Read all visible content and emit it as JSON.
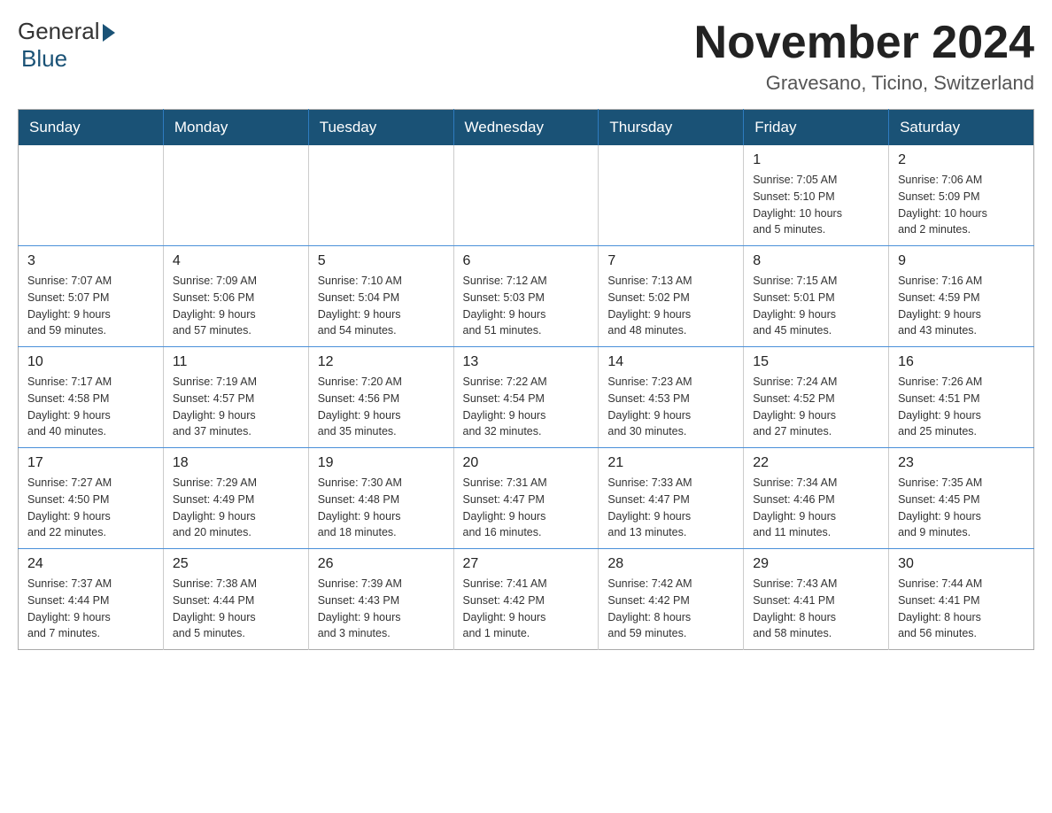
{
  "header": {
    "logo_general": "General",
    "logo_blue": "Blue",
    "month_title": "November 2024",
    "location": "Gravesano, Ticino, Switzerland"
  },
  "weekdays": [
    "Sunday",
    "Monday",
    "Tuesday",
    "Wednesday",
    "Thursday",
    "Friday",
    "Saturday"
  ],
  "weeks": [
    [
      {
        "day": "",
        "info": ""
      },
      {
        "day": "",
        "info": ""
      },
      {
        "day": "",
        "info": ""
      },
      {
        "day": "",
        "info": ""
      },
      {
        "day": "",
        "info": ""
      },
      {
        "day": "1",
        "info": "Sunrise: 7:05 AM\nSunset: 5:10 PM\nDaylight: 10 hours\nand 5 minutes."
      },
      {
        "day": "2",
        "info": "Sunrise: 7:06 AM\nSunset: 5:09 PM\nDaylight: 10 hours\nand 2 minutes."
      }
    ],
    [
      {
        "day": "3",
        "info": "Sunrise: 7:07 AM\nSunset: 5:07 PM\nDaylight: 9 hours\nand 59 minutes."
      },
      {
        "day": "4",
        "info": "Sunrise: 7:09 AM\nSunset: 5:06 PM\nDaylight: 9 hours\nand 57 minutes."
      },
      {
        "day": "5",
        "info": "Sunrise: 7:10 AM\nSunset: 5:04 PM\nDaylight: 9 hours\nand 54 minutes."
      },
      {
        "day": "6",
        "info": "Sunrise: 7:12 AM\nSunset: 5:03 PM\nDaylight: 9 hours\nand 51 minutes."
      },
      {
        "day": "7",
        "info": "Sunrise: 7:13 AM\nSunset: 5:02 PM\nDaylight: 9 hours\nand 48 minutes."
      },
      {
        "day": "8",
        "info": "Sunrise: 7:15 AM\nSunset: 5:01 PM\nDaylight: 9 hours\nand 45 minutes."
      },
      {
        "day": "9",
        "info": "Sunrise: 7:16 AM\nSunset: 4:59 PM\nDaylight: 9 hours\nand 43 minutes."
      }
    ],
    [
      {
        "day": "10",
        "info": "Sunrise: 7:17 AM\nSunset: 4:58 PM\nDaylight: 9 hours\nand 40 minutes."
      },
      {
        "day": "11",
        "info": "Sunrise: 7:19 AM\nSunset: 4:57 PM\nDaylight: 9 hours\nand 37 minutes."
      },
      {
        "day": "12",
        "info": "Sunrise: 7:20 AM\nSunset: 4:56 PM\nDaylight: 9 hours\nand 35 minutes."
      },
      {
        "day": "13",
        "info": "Sunrise: 7:22 AM\nSunset: 4:54 PM\nDaylight: 9 hours\nand 32 minutes."
      },
      {
        "day": "14",
        "info": "Sunrise: 7:23 AM\nSunset: 4:53 PM\nDaylight: 9 hours\nand 30 minutes."
      },
      {
        "day": "15",
        "info": "Sunrise: 7:24 AM\nSunset: 4:52 PM\nDaylight: 9 hours\nand 27 minutes."
      },
      {
        "day": "16",
        "info": "Sunrise: 7:26 AM\nSunset: 4:51 PM\nDaylight: 9 hours\nand 25 minutes."
      }
    ],
    [
      {
        "day": "17",
        "info": "Sunrise: 7:27 AM\nSunset: 4:50 PM\nDaylight: 9 hours\nand 22 minutes."
      },
      {
        "day": "18",
        "info": "Sunrise: 7:29 AM\nSunset: 4:49 PM\nDaylight: 9 hours\nand 20 minutes."
      },
      {
        "day": "19",
        "info": "Sunrise: 7:30 AM\nSunset: 4:48 PM\nDaylight: 9 hours\nand 18 minutes."
      },
      {
        "day": "20",
        "info": "Sunrise: 7:31 AM\nSunset: 4:47 PM\nDaylight: 9 hours\nand 16 minutes."
      },
      {
        "day": "21",
        "info": "Sunrise: 7:33 AM\nSunset: 4:47 PM\nDaylight: 9 hours\nand 13 minutes."
      },
      {
        "day": "22",
        "info": "Sunrise: 7:34 AM\nSunset: 4:46 PM\nDaylight: 9 hours\nand 11 minutes."
      },
      {
        "day": "23",
        "info": "Sunrise: 7:35 AM\nSunset: 4:45 PM\nDaylight: 9 hours\nand 9 minutes."
      }
    ],
    [
      {
        "day": "24",
        "info": "Sunrise: 7:37 AM\nSunset: 4:44 PM\nDaylight: 9 hours\nand 7 minutes."
      },
      {
        "day": "25",
        "info": "Sunrise: 7:38 AM\nSunset: 4:44 PM\nDaylight: 9 hours\nand 5 minutes."
      },
      {
        "day": "26",
        "info": "Sunrise: 7:39 AM\nSunset: 4:43 PM\nDaylight: 9 hours\nand 3 minutes."
      },
      {
        "day": "27",
        "info": "Sunrise: 7:41 AM\nSunset: 4:42 PM\nDaylight: 9 hours\nand 1 minute."
      },
      {
        "day": "28",
        "info": "Sunrise: 7:42 AM\nSunset: 4:42 PM\nDaylight: 8 hours\nand 59 minutes."
      },
      {
        "day": "29",
        "info": "Sunrise: 7:43 AM\nSunset: 4:41 PM\nDaylight: 8 hours\nand 58 minutes."
      },
      {
        "day": "30",
        "info": "Sunrise: 7:44 AM\nSunset: 4:41 PM\nDaylight: 8 hours\nand 56 minutes."
      }
    ]
  ]
}
